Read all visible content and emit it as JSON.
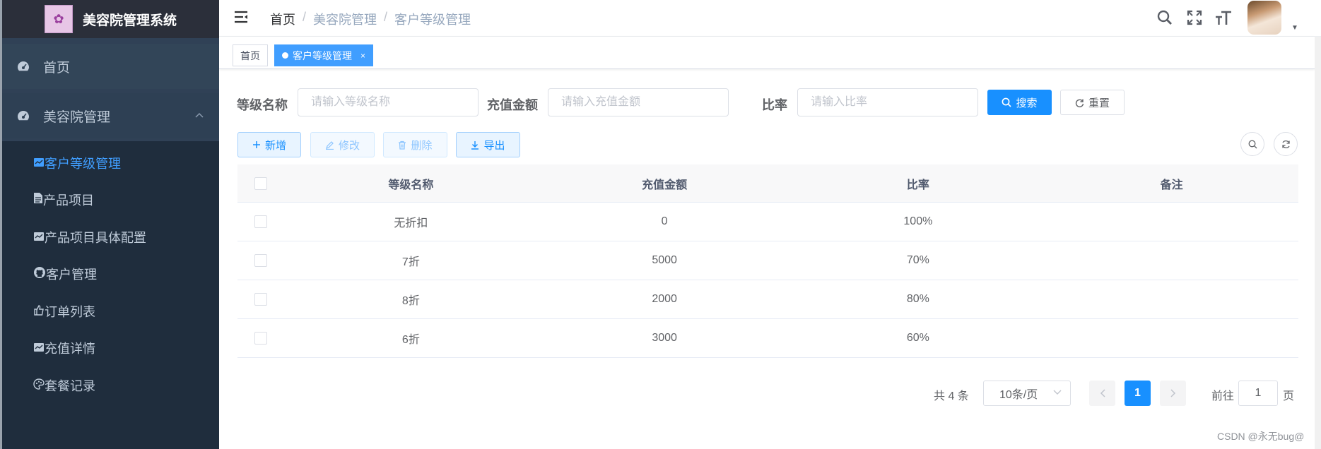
{
  "app": {
    "title": "美容院管理系统",
    "logo_icon": "logo-flower-icon"
  },
  "sidebar": {
    "home": {
      "label": "首页",
      "icon": "dashboard-icon"
    },
    "group": {
      "label": "美容院管理",
      "icon": "dashboard-icon",
      "expanded": true
    },
    "items": [
      {
        "label": "客户等级管理",
        "icon": "chart-icon",
        "active": true
      },
      {
        "label": "产品项目",
        "icon": "document-icon"
      },
      {
        "label": "产品项目具体配置",
        "icon": "chart-icon"
      },
      {
        "label": "客户管理",
        "icon": "github-icon"
      },
      {
        "label": "订单列表",
        "icon": "thumb-icon"
      },
      {
        "label": "充值详情",
        "icon": "chart-icon"
      },
      {
        "label": "套餐记录",
        "icon": "palette-icon"
      }
    ]
  },
  "navbar": {
    "breadcrumb": [
      "首页",
      "美容院管理",
      "客户等级管理"
    ],
    "separator": "/",
    "tools": [
      "search-icon",
      "fullscreen-icon",
      "font-size-icon"
    ]
  },
  "tags": [
    {
      "label": "首页"
    },
    {
      "label": "客户等级管理",
      "active": true,
      "close": "×"
    }
  ],
  "search_form": {
    "fields": [
      {
        "label": "等级名称",
        "placeholder": "请输入等级名称"
      },
      {
        "label": "充值金额",
        "placeholder": "请输入充值金额"
      },
      {
        "label": "比率",
        "placeholder": "请输入比率"
      }
    ],
    "search_label": "搜索",
    "reset_label": "重置"
  },
  "toolbar": {
    "add_label": "新增",
    "edit_label": "修改",
    "delete_label": "删除",
    "export_label": "导出"
  },
  "table": {
    "columns": [
      "等级名称",
      "充值金额",
      "比率",
      "备注"
    ],
    "rows": [
      [
        "无折扣",
        "0",
        "100%",
        ""
      ],
      [
        "7折",
        "5000",
        "70%",
        ""
      ],
      [
        "8折",
        "2000",
        "80%",
        ""
      ],
      [
        "6折",
        "3000",
        "60%",
        ""
      ]
    ]
  },
  "pagination": {
    "total_text": "共 4 条",
    "page_size": "10条/页",
    "current_page": "1",
    "goto_prefix": "前往",
    "goto_value": "1",
    "goto_suffix": "页"
  },
  "watermark": "CSDN @永无bug@",
  "colors": {
    "primary": "#1890ff",
    "sidebar_bg": "#304156",
    "submenu_bg": "#1f2d3d",
    "active_text": "#409eff"
  }
}
